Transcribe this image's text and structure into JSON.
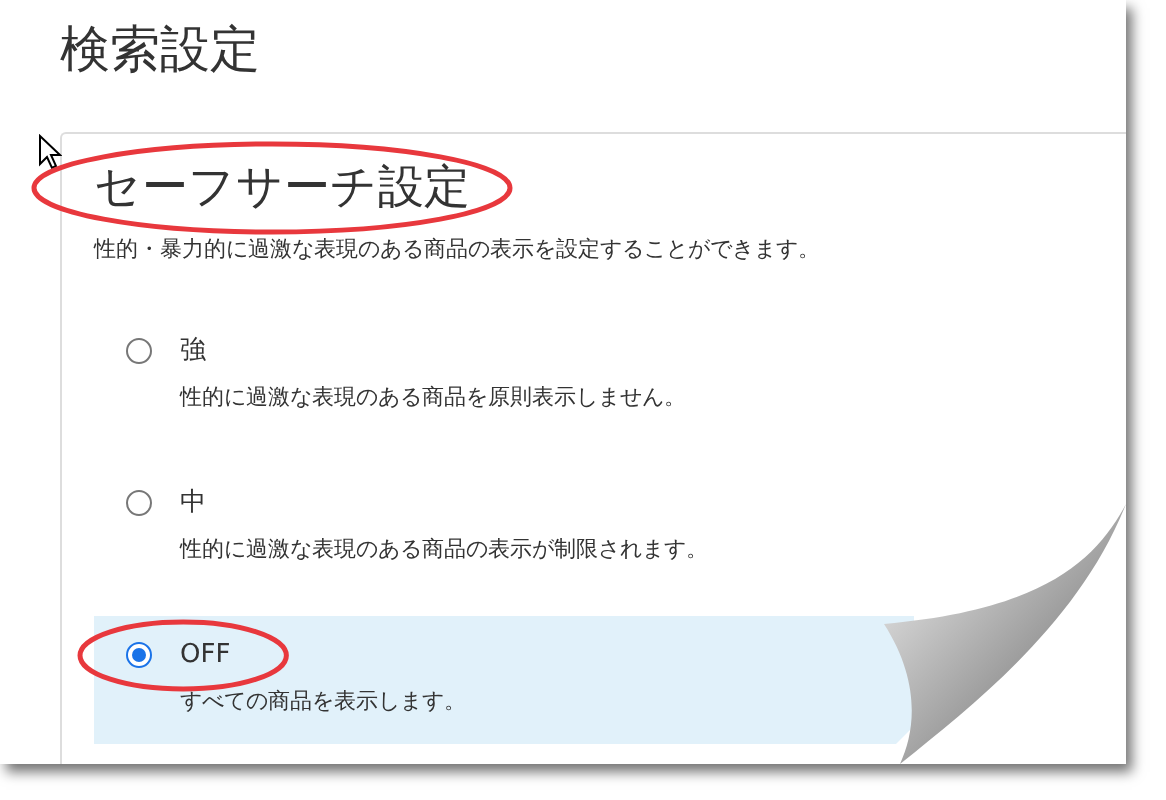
{
  "page": {
    "title": "検索設定"
  },
  "section": {
    "title": "セーフサーチ設定",
    "description": "性的・暴力的に過激な表現のある商品の表示を設定することができます。",
    "circled": true
  },
  "options": [
    {
      "label": "強",
      "description": "性的に過激な表現のある商品を原則表示しません。",
      "selected": false,
      "circled": false
    },
    {
      "label": "中",
      "description": "性的に過激な表現のある商品の表示が制限されます。",
      "selected": false,
      "circled": false
    },
    {
      "label": "OFF",
      "description": "すべての商品を表示します。",
      "selected": true,
      "circled": true
    }
  ]
}
